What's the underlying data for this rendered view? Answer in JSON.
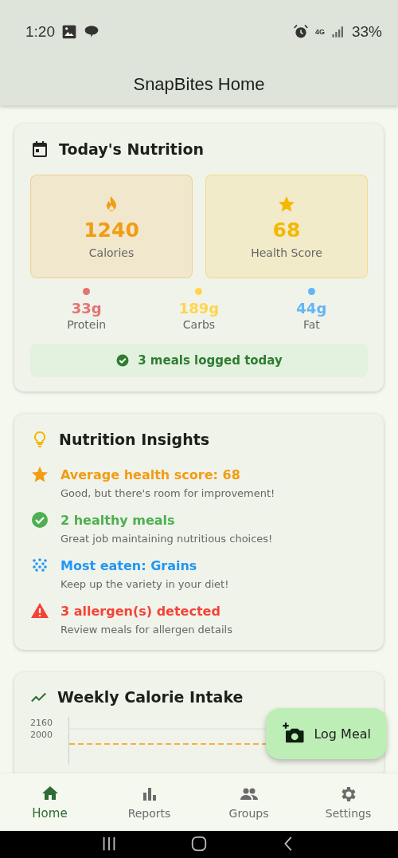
{
  "status_bar": {
    "time": "1:20",
    "network": "4G",
    "battery": "33%"
  },
  "app_bar": {
    "title": "SnapBites Home"
  },
  "today": {
    "title": "Today's Nutrition",
    "stats": [
      {
        "kind": "calories",
        "value": "1240",
        "label": "Calories",
        "color": "#f39c12"
      },
      {
        "kind": "score",
        "value": "68",
        "label": "Health Score",
        "color": "#f5b800"
      }
    ],
    "macros": [
      {
        "value": "33g",
        "label": "Protein",
        "color": "#e57373"
      },
      {
        "value": "189g",
        "label": "Carbs",
        "color": "#ffd54f"
      },
      {
        "value": "44g",
        "label": "Fat",
        "color": "#64b5f6"
      }
    ],
    "logged": "3 meals logged today"
  },
  "insights": {
    "title": "Nutrition Insights",
    "items": [
      {
        "kind": "star",
        "title": "Average health score: 68",
        "detail": "Good, but there's room for improvement!",
        "color": "#f39c12"
      },
      {
        "kind": "check",
        "title": "2 healthy meals",
        "detail": "Great job maintaining nutritious choices!",
        "color": "#4caf50"
      },
      {
        "kind": "grain",
        "title": "Most eaten: Grains",
        "detail": "Keep up the variety in your diet!",
        "color": "#2196f3"
      },
      {
        "kind": "warning",
        "title": "3 allergen(s) detected",
        "detail": "Review meals for allergen details",
        "color": "#f44336"
      }
    ]
  },
  "weekly": {
    "title": "Weekly Calorie Intake",
    "y_labels": [
      "2160",
      "2000"
    ]
  },
  "fab": {
    "label": "Log Meal"
  },
  "bottom_nav": [
    {
      "kind": "home",
      "label": "Home",
      "selected": true
    },
    {
      "kind": "reports",
      "label": "Reports",
      "selected": false
    },
    {
      "kind": "groups",
      "label": "Groups",
      "selected": false
    },
    {
      "kind": "settings",
      "label": "Settings",
      "selected": false
    }
  ]
}
